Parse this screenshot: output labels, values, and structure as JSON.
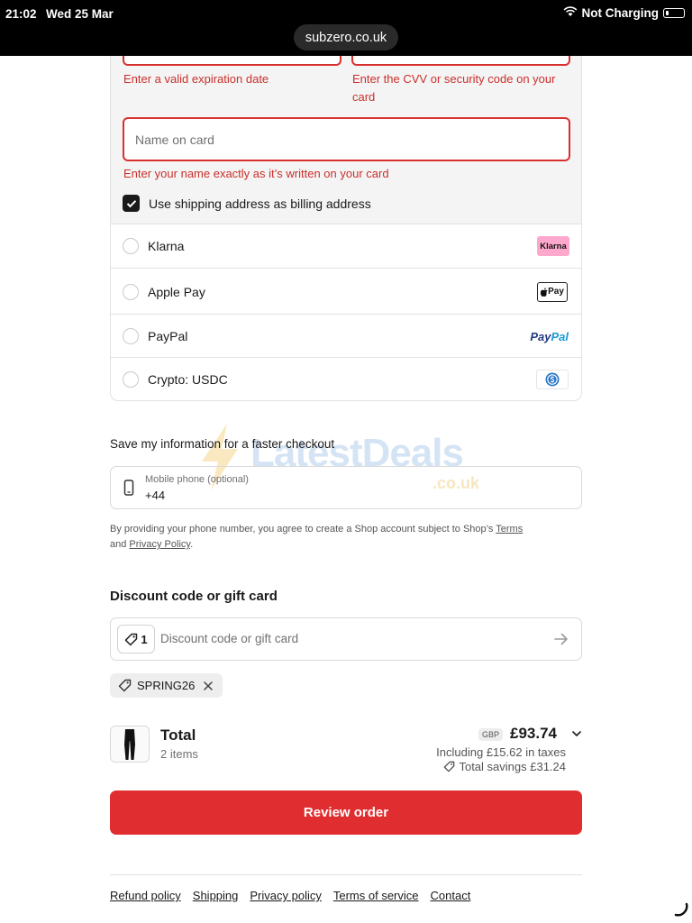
{
  "status_bar": {
    "time": "21:02",
    "date": "Wed 25 Mar",
    "battery_text": "Not Charging"
  },
  "browser": {
    "url": "subzero.co.uk"
  },
  "card_form": {
    "expiry_error": "Enter a valid expiration date",
    "cvv_error": "Enter the CVV or security code on your card",
    "name_placeholder": "Name on card",
    "name_error": "Enter your name exactly as it’s written on your card",
    "billing_checkbox_label": "Use shipping address as billing address",
    "billing_checked": true
  },
  "payment_methods": [
    {
      "label": "Klarna",
      "logo_text": "Klarna",
      "icon": "klarna-logo"
    },
    {
      "label": "Apple Pay",
      "logo_text": "Pay",
      "icon": "apple-pay-logo"
    },
    {
      "label": "PayPal",
      "logo_text_1": "Pay",
      "logo_text_2": "Pal",
      "icon": "paypal-logo"
    },
    {
      "label": "Crypto: USDC",
      "icon": "usdc-logo"
    }
  ],
  "save_info": {
    "title": "Save my information for a faster checkout",
    "phone_label": "Mobile phone (optional)",
    "phone_value": "+44",
    "legal_prefix": "By providing your phone number, you agree to create a Shop account subject to Shop’s ",
    "legal_terms": "Terms",
    "legal_and": " and ",
    "legal_privacy": "Privacy Policy",
    "legal_end": "."
  },
  "watermark": {
    "text": "LatestDeals",
    "sub": ".co.uk"
  },
  "discount": {
    "title": "Discount code or gift card",
    "badge_count": "1",
    "placeholder": "Discount code or gift card",
    "applied_code": "SPRING26"
  },
  "summary": {
    "total_label": "Total",
    "items_count": "2 items",
    "currency": "GBP",
    "total_price": "£93.74",
    "taxes": "Including £15.62 in taxes",
    "savings": "Total savings £31.24"
  },
  "review_button": "Review order",
  "footer": {
    "links": [
      "Refund policy",
      "Shipping",
      "Privacy policy",
      "Terms of service",
      "Contact"
    ]
  },
  "colors": {
    "accent": "#e02d2f",
    "error": "#c9302c",
    "klarna": "#ffa8cd"
  }
}
